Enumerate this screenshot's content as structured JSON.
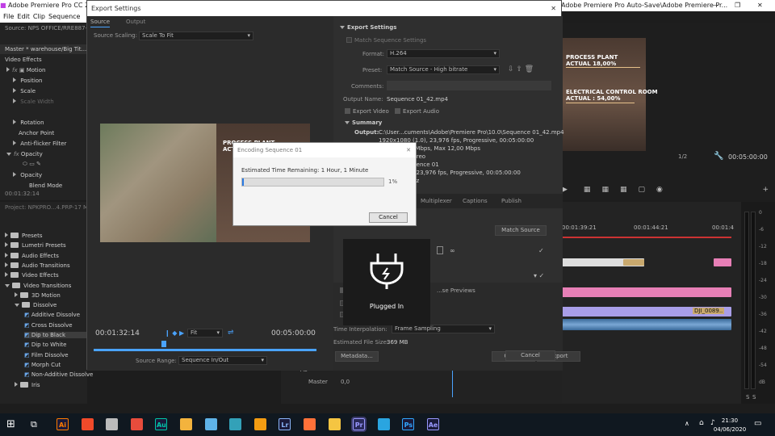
{
  "window": {
    "title_left": "Adobe Premiere Pro CC 2019",
    "title_right": "Adobe Premiere Pro Auto-Save\\Adobe Premiere Pr...",
    "menu": [
      "File",
      "Edit",
      "Clip",
      "Sequence",
      "M"
    ]
  },
  "left_panel": {
    "source_label": "Source: NPS OFFICE/RRE887-»",
    "master_label": "Master * warehouse/Big Tit...",
    "effect_controls_tab": "Video Effects",
    "effects": [
      "Motion",
      "Position",
      "Scale",
      "Scale Width",
      "Rotation",
      "Anchor Point",
      "Anti-flicker Filter",
      "Opacity",
      "Opacity",
      "Blend Mode"
    ],
    "timecode": "00:01:32:14"
  },
  "project_panel": {
    "label": "Project: NPKPRO...4.PRP-17 M...",
    "items": [
      {
        "label": "Presets",
        "type": "folder",
        "indent": 0,
        "open": false
      },
      {
        "label": "Lumetri Presets",
        "type": "folder",
        "indent": 0,
        "open": false
      },
      {
        "label": "Audio Effects",
        "type": "folder",
        "indent": 0,
        "open": false
      },
      {
        "label": "Audio Transitions",
        "type": "folder",
        "indent": 0,
        "open": false
      },
      {
        "label": "Video Effects",
        "type": "folder",
        "indent": 0,
        "open": false
      },
      {
        "label": "Video Transitions",
        "type": "folder",
        "indent": 0,
        "open": true
      },
      {
        "label": "3D Motion",
        "type": "folder",
        "indent": 1,
        "open": false
      },
      {
        "label": "Dissolve",
        "type": "folder",
        "indent": 1,
        "open": true
      },
      {
        "label": "Additive Dissolve",
        "type": "fx",
        "indent": 2
      },
      {
        "label": "Cross Dissolve",
        "type": "fx",
        "indent": 2
      },
      {
        "label": "Dip to Black",
        "type": "fx",
        "indent": 2,
        "selected": true
      },
      {
        "label": "Dip to White",
        "type": "fx",
        "indent": 2
      },
      {
        "label": "Film Dissolve",
        "type": "fx",
        "indent": 2
      },
      {
        "label": "Morph Cut",
        "type": "fx",
        "indent": 2
      },
      {
        "label": "Non-Additive Dissolve",
        "type": "fx",
        "indent": 2
      },
      {
        "label": "Iris",
        "type": "folder",
        "indent": 1,
        "open": false
      }
    ]
  },
  "export_dialog": {
    "title": "Export Settings",
    "tabs": [
      "Source",
      "Output"
    ],
    "source_scaling_label": "Source Scaling:",
    "source_scaling_value": "Scale To Fit",
    "section_export": "Export Settings",
    "match_sequence": "Match Sequence Settings",
    "format_label": "Format:",
    "format_value": "H.264",
    "preset_label": "Preset:",
    "preset_value": "Match Source - High bitrate",
    "comments_label": "Comments:",
    "output_name_label": "Output Name:",
    "output_name_value": "Sequence 01_42.mp4",
    "export_video": "Export Video",
    "export_audio": "Export Audio",
    "summary_label": "Summary",
    "output_label": "Output:",
    "output_lines": [
      "C:\\User...cuments\\Adobe\\Premiere Pro\\10.0\\Sequence 01_42.mp4",
      "1920x1080 (1.0), 23,976 fps, Progressive, 00:05:00:00",
      "...rget 10,00 Mbps, Max 12,00 Mbps",
      "...48 kHz, Stereo"
    ],
    "source_lines": [
      "...ence 01",
      "...23,976 fps, Progressive, 00:05:00:00",
      "...z"
    ],
    "tabs2": [
      "Multiplexer",
      "Captions",
      "Publish"
    ],
    "match_source_btn": "Match Source",
    "use_previews": "...se Previews",
    "time_interp_label": "Time Interpolation:",
    "time_interp_value": "Frame Sampling",
    "est_size_label": "Estimated File Size:",
    "est_size_value": "369 MB",
    "buttons": {
      "metadata": "Metadata...",
      "queue": "Queue",
      "export": "Export",
      "cancel": "Cancel"
    },
    "preview_timecode_left": "00:01:32:14",
    "preview_fit": "Fit",
    "preview_timecode_right": "00:05:00:00",
    "source_range_label": "Source Range:",
    "source_range_value": "Sequence In/Out",
    "preview_texts": [
      "PROCESS PLANT",
      "ACT..."
    ]
  },
  "encoding_dialog": {
    "title": "Encoding Sequence 01",
    "remaining": "Estimated Time Remaining: 1 Hour, 1 Minute",
    "progress": 1,
    "progress_label": "1%",
    "cancel": "Cancel"
  },
  "toast": {
    "label": "Plugged In"
  },
  "program_monitor": {
    "text_lines": [
      "PROCESS PLANT",
      "ACTUAL 18,00%",
      "ELECTRICAL CONTROL ROOM",
      "ACTUAL : 54,00%"
    ],
    "zoom": "1/2",
    "timecode": "00:05:00:00"
  },
  "timeline": {
    "ruler": [
      "00:01:39:21",
      "00:01:44:21",
      "00:01:4"
    ],
    "clip_label": "DJI_0089..",
    "audio_track_a5": "A5",
    "master": "Master",
    "master_value": "0,0",
    "meter_ticks": [
      "0",
      "-6",
      "-12",
      "-18",
      "-24",
      "-30",
      "-36",
      "-42",
      "-48",
      "-54",
      "dB"
    ],
    "meter_solo": [
      "S",
      "S"
    ]
  },
  "taskbar": {
    "apps": [
      {
        "name": "illustrator",
        "label": "Ai",
        "color": "#ff7c00"
      },
      {
        "name": "bulb",
        "label": "",
        "color": "#f04a2a"
      },
      {
        "name": "craft",
        "label": "",
        "color": "#bbbbbb"
      },
      {
        "name": "office",
        "label": "",
        "color": "#e74c3c"
      },
      {
        "name": "audition",
        "label": "Au",
        "color": "#00c8a8"
      },
      {
        "name": "photo",
        "label": "",
        "color": "#f3b33d"
      },
      {
        "name": "pen",
        "label": "",
        "color": "#5fb3e8"
      },
      {
        "name": "sublime",
        "label": "",
        "color": "#33a1b8"
      },
      {
        "name": "vlc",
        "label": "",
        "color": "#f39c12"
      },
      {
        "name": "lightroom",
        "label": "Lr",
        "color": "#8ab4f8"
      },
      {
        "name": "firefox",
        "label": "",
        "color": "#ff7139"
      },
      {
        "name": "explorer",
        "label": "",
        "color": "#f5c542"
      },
      {
        "name": "premiere",
        "label": "Pr",
        "color": "#9999ff"
      },
      {
        "name": "telegram",
        "label": "",
        "color": "#2aa5e0"
      },
      {
        "name": "photoshop",
        "label": "Ps",
        "color": "#31a8ff"
      },
      {
        "name": "aftereffects",
        "label": "Ae",
        "color": "#9999ff"
      }
    ],
    "time": "21:30",
    "date": "04/06/2020"
  }
}
